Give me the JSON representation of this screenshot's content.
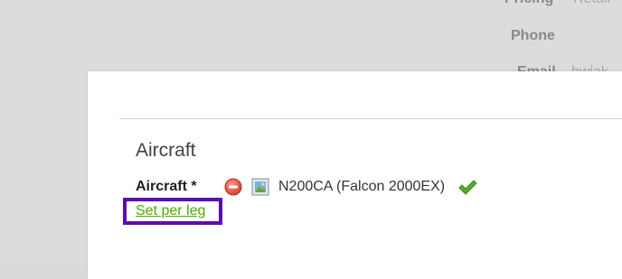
{
  "background": {
    "pricing_label": "Pricing",
    "pricing_value": "Retail",
    "phone_label": "Phone",
    "email_label": "Email",
    "email_value": "hwiak"
  },
  "modal": {
    "section_title": "Aircraft",
    "aircraft_field": {
      "label": "Aircraft *",
      "value": "N200CA (Falcon 2000EX)",
      "remove_icon": "remove-icon",
      "image_icon": "image-icon",
      "status_icon": "check-icon"
    },
    "set_per_leg_link": "Set per leg"
  },
  "colors": {
    "link": "#4caa00",
    "highlight_border": "#5b0db0",
    "remove": "#e05a4a",
    "check": "#5aa832"
  }
}
